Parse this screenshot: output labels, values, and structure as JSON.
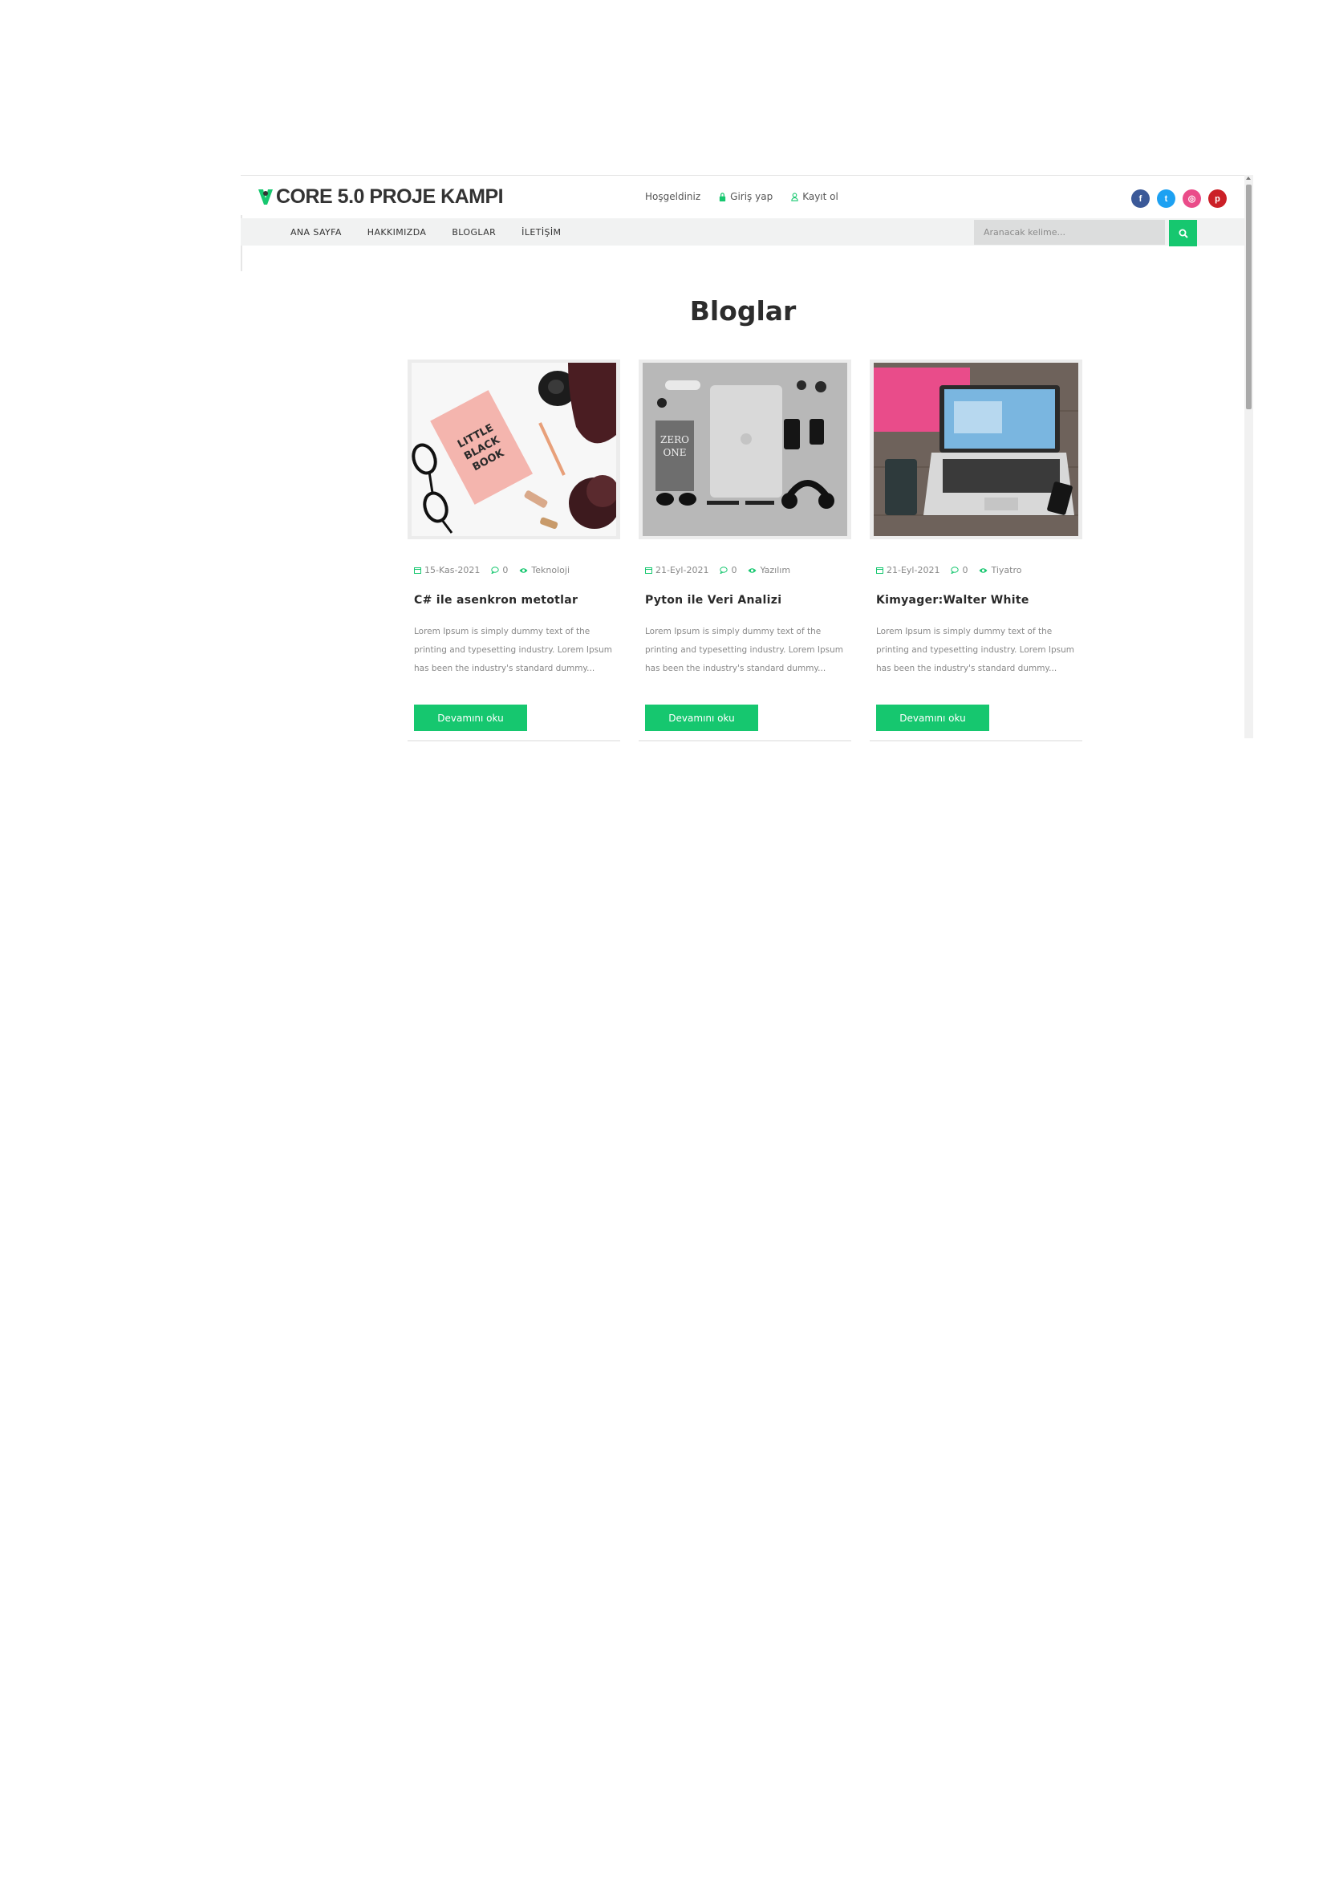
{
  "brand": {
    "title": "CORE 5.0 PROJE KAMPI"
  },
  "header": {
    "welcome": "Hoşgeldiniz",
    "login": "Giriş yap",
    "register": "Kayıt ol",
    "accent": "#16c76f"
  },
  "social": [
    {
      "icon": "facebook-icon",
      "glyph": "f",
      "color": "#3b5998"
    },
    {
      "icon": "twitter-icon",
      "glyph": "t",
      "color": "#1da1f2"
    },
    {
      "icon": "dribbble-icon",
      "glyph": "◎",
      "color": "#ea4c89"
    },
    {
      "icon": "pinterest-icon",
      "glyph": "p",
      "color": "#cb2027"
    }
  ],
  "nav": {
    "items": [
      "ANA SAYFA",
      "HAKKIMIZDA",
      "BLOGLAR",
      "İLETİŞİM"
    ]
  },
  "search": {
    "placeholder": "Aranacak kelime..."
  },
  "page": {
    "title": "Bloglar"
  },
  "posts": [
    {
      "date": "15-Kas-2021",
      "comments": "0",
      "category": "Teknoloji",
      "title": "C# ile asenkron metotlar",
      "excerpt": "Lorem Ipsum is simply dummy text of the printing and typesetting industry. Lorem Ipsum has been the industry's standard dummy...",
      "button": "Devamını oku",
      "image": "little-black-book-flatlay"
    },
    {
      "date": "21-Eyl-2021",
      "comments": "0",
      "category": "Yazılım",
      "title": "Pyton ile Veri Analizi",
      "excerpt": "Lorem Ipsum is simply dummy text of the printing and typesetting industry. Lorem Ipsum has been the industry's standard dummy...",
      "button": "Devamını oku",
      "image": "laptop-gadgets-flatlay"
    },
    {
      "date": "21-Eyl-2021",
      "comments": "0",
      "category": "Tiyatro",
      "title": "Kimyager:Walter White",
      "excerpt": "Lorem Ipsum is simply dummy text of the printing and typesetting industry. Lorem Ipsum has been the industry's standard dummy...",
      "button": "Devamını oku",
      "image": "laptop-desk-workspace"
    }
  ]
}
